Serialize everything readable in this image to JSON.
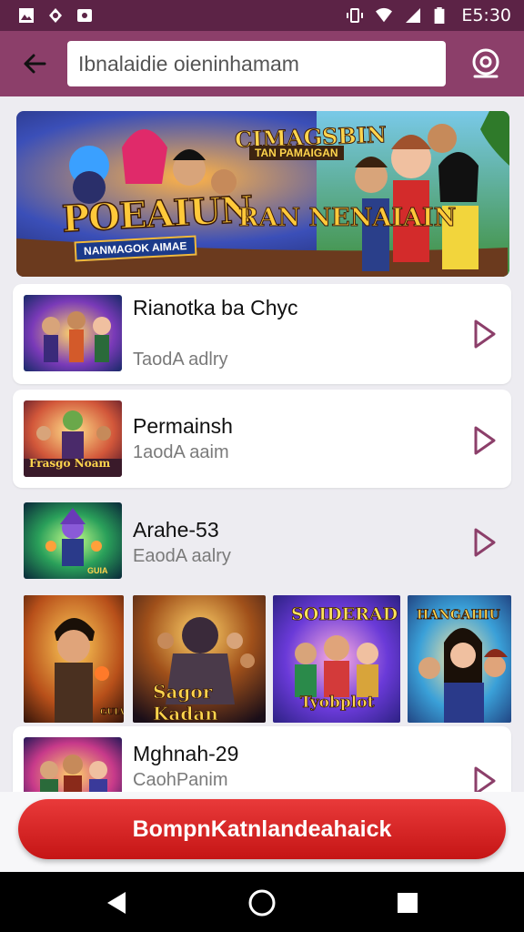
{
  "status_bar": {
    "time": "E5:30",
    "left_icons": [
      "image-icon",
      "pin-icon",
      "photo-icon"
    ],
    "right_icons": [
      "vibrate-icon",
      "wifi-icon",
      "signal-icon",
      "battery-icon"
    ]
  },
  "app_bar": {
    "search_value": "Ibnalaidie oieninhamam",
    "colors": {
      "bar": "#8c3f6a",
      "status": "#5c2346"
    }
  },
  "banner": {
    "title_main": "POEAIUN",
    "title_main_sub": "NANMAGOK AIMAE",
    "title_side": "RAN NENAIAIN",
    "title_top": "CIMAGSBIN",
    "title_top_sub": "TAN PAMAIGAN"
  },
  "list": [
    {
      "title": "Rianotka ba Chyc",
      "subtitle": "TaodA adlry"
    },
    {
      "title": "Permainsh",
      "subtitle": "1aodA aaim"
    },
    {
      "title": "Arahe-53",
      "subtitle": "EaodA aalry"
    },
    {
      "title": "Mghnah-29",
      "subtitle": "CaohPanim"
    }
  ],
  "thumb_captions": [
    "Frasgo Noam",
    "GUIA"
  ],
  "grid_captions": [
    "GUIA",
    "Sagor Kadan",
    "SOIDERAD",
    "Tyobplot",
    "HANGAHIU"
  ],
  "cta": {
    "label": "BompnKatnlandeahaick",
    "color": "#d92020"
  },
  "nav": {
    "icons": [
      "back-triangle-icon",
      "home-circle-icon",
      "recents-square-icon"
    ]
  }
}
